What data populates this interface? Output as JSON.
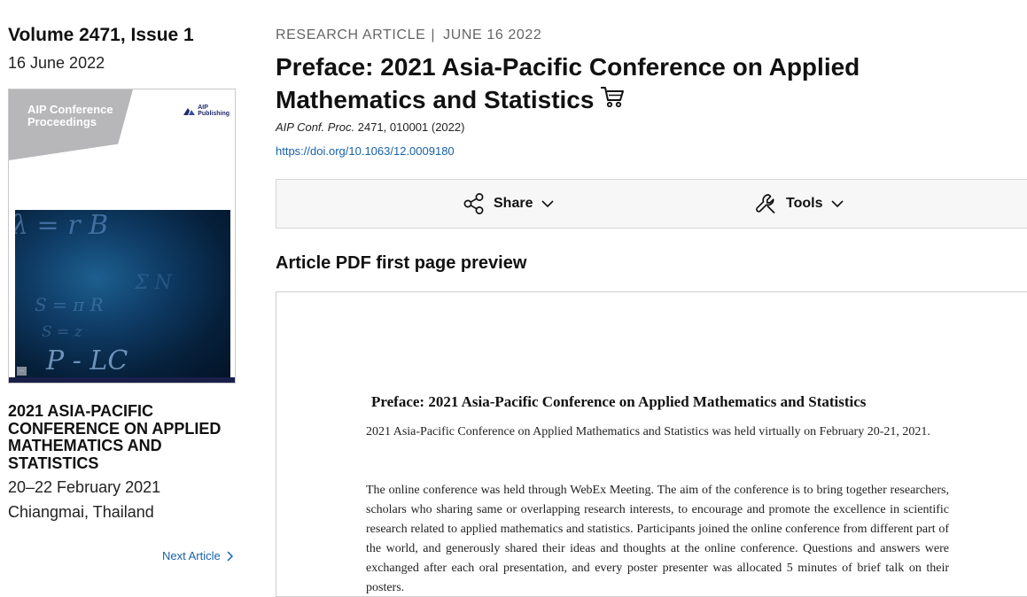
{
  "issue": {
    "title": "Volume 2471, Issue 1",
    "date": "16 June 2022"
  },
  "cover": {
    "series_line1": "AIP Conference",
    "series_line2": "Proceedings",
    "publisher_line1": "AIP",
    "publisher_line2": "Publishing",
    "art_text": "P - LC",
    "accent_color": "#1a1f4a"
  },
  "conference": {
    "title": "2021 ASIA-PACIFIC CONFERENCE ON APPLIED MATHEMATICS AND STATISTICS",
    "dates": "20–22 February 2021",
    "place": "Chiangmai, Thailand"
  },
  "nav": {
    "next_article": "Next Article"
  },
  "article": {
    "type": "RESEARCH ARTICLE",
    "separator": "|",
    "date": "JUNE 16 2022",
    "title": "Preface: 2021 Asia-Pacific Conference on Applied Mathematics and Statistics",
    "journal": "AIP Conf. Proc.",
    "citation_rest": "2471, 010001 (2022)",
    "doi": "https://doi.org/10.1063/12.0009180",
    "link_color": "#1762a9"
  },
  "toolbar": {
    "share_label": "Share",
    "tools_label": "Tools",
    "share_icon": "share-icon",
    "tools_icon": "wrench-icon"
  },
  "preview": {
    "heading": "Article PDF first page preview",
    "pdf_title": "Preface: 2021 Asia-Pacific Conference on Applied Mathematics and Statistics",
    "pdf_p1": "2021 Asia-Pacific Conference on Applied Mathematics and Statistics was held virtually on February 20-21, 2021.",
    "pdf_p2": "The online conference was held through WebEx Meeting. The aim of the conference is to bring together researchers, scholars who sharing same or overlapping research interests, to encourage and promote the excellence in scientific research related to applied mathematics and statistics. Participants joined the online conference from different part of the world, and generously shared their ideas and thoughts at the online conference. Questions and answers were exchanged after each oral presentation, and every poster presenter was allocated 5 minutes of brief talk on their posters."
  }
}
